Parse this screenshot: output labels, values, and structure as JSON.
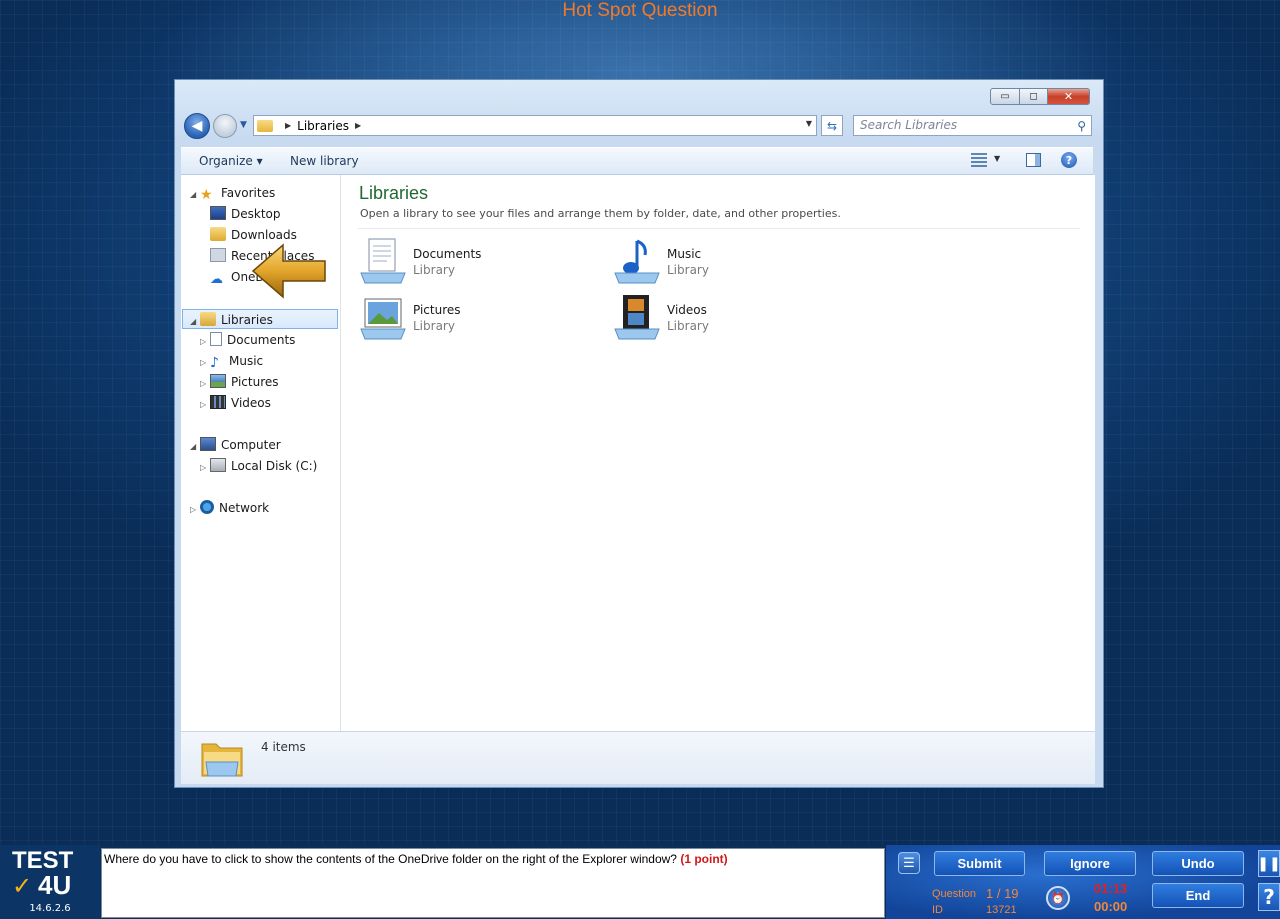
{
  "page": {
    "title": "Hot Spot Question"
  },
  "window": {
    "controls": {
      "minimize": "▭",
      "maximize": "◻",
      "close": "✕"
    },
    "address": {
      "crumb": "Libraries"
    },
    "search": {
      "placeholder": "Search Libraries"
    },
    "toolbar": {
      "organize": "Organize ▾",
      "new_library": "New library"
    }
  },
  "nav": {
    "favorites": "Favorites",
    "desktop": "Desktop",
    "downloads": "Downloads",
    "recent": "Recent Places",
    "onedrive": "OneDrive",
    "libraries": "Libraries",
    "documents": "Documents",
    "music": "Music",
    "pictures": "Pictures",
    "videos": "Videos",
    "computer": "Computer",
    "local_disk": "Local Disk (C:)",
    "network": "Network"
  },
  "main": {
    "title": "Libraries",
    "subtitle": "Open a library to see your files and arrange them by folder, date, and other properties.",
    "items": [
      {
        "name": "Documents",
        "type": "Library"
      },
      {
        "name": "Music",
        "type": "Library"
      },
      {
        "name": "Pictures",
        "type": "Library"
      },
      {
        "name": "Videos",
        "type": "Library"
      }
    ]
  },
  "status": {
    "count": "4 items"
  },
  "testbar": {
    "logo_top": "TEST",
    "logo_bottom": "4U",
    "version": "14.6.2.6",
    "question_text": "Where do you have to click to show the contents of the OneDrive folder on the right of the Explorer window?",
    "question_points": "(1 point)",
    "buttons": {
      "submit": "Submit",
      "ignore": "Ignore",
      "undo": "Undo",
      "end": "End"
    },
    "question_label": "Question",
    "question_value": "1 / 19",
    "id_label": "ID",
    "id_value": "13721",
    "time_elapsed": "01:13",
    "time_remaining": "00:00"
  },
  "colors": {
    "accent_orange": "#f07a2a",
    "library_title_green": "#1e6a2f",
    "points_red": "#d01818"
  }
}
